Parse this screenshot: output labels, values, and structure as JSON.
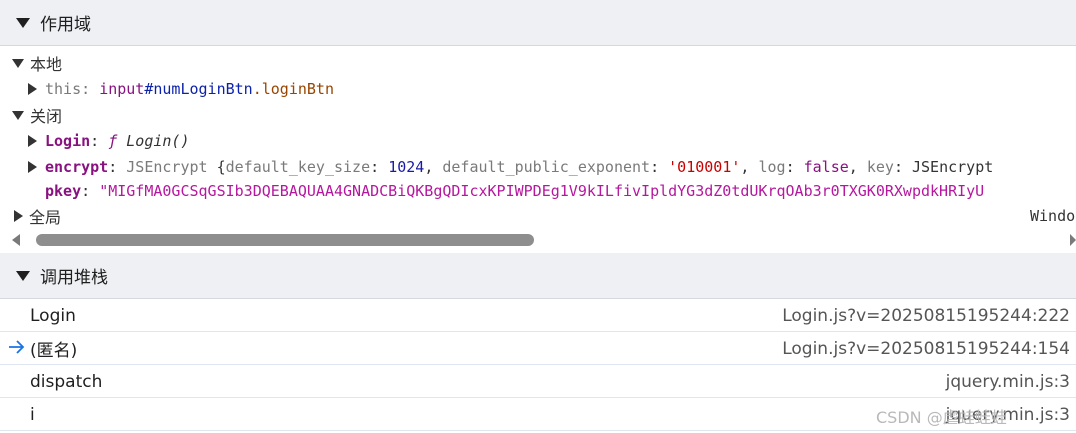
{
  "scope_section": {
    "title": "作用域"
  },
  "scope": {
    "local": {
      "label": "本地",
      "this_key": "this",
      "this_value_tag": "input",
      "this_value_id": "#numLoginBtn",
      "this_value_class": ".loginBtn"
    },
    "closure": {
      "label": "关闭",
      "login_key": "Login",
      "login_value_f": "ƒ",
      "login_value_name": "Login()",
      "encrypt_key": "encrypt",
      "encrypt_type": "JSEncrypt",
      "encrypt_brace": "{",
      "encrypt_p1_key": "default_key_size",
      "encrypt_p1_val": "1024",
      "encrypt_p2_key": "default_public_exponent",
      "encrypt_p2_val": "'010001'",
      "encrypt_p3_key": "log",
      "encrypt_p3_val": "false",
      "encrypt_p4_key": "key",
      "encrypt_p4_val": "JSEncrypt",
      "pkey_key": "pkey",
      "pkey_value": "\"MIGfMA0GCSqGSIb3DQEBAQUAA4GNADCBiQKBgQDIcxKPIWPDEg1V9kILfivIpldYG3dZ0tdUKrqOAb3r0TXGK0RXwpdkHRIyU"
    },
    "global": {
      "label": "全局",
      "value": "Windo"
    }
  },
  "callstack_section": {
    "title": "调用堆栈"
  },
  "callstack": [
    {
      "name": "Login",
      "location": "Login.js?v=20250815195244:222",
      "current": false
    },
    {
      "name": "(匿名)",
      "location": "Login.js?v=20250815195244:154",
      "current": true
    },
    {
      "name": "dispatch",
      "location": "jquery.min.js:3",
      "current": false
    },
    {
      "name": "i",
      "location": "jquery.min.js:3",
      "current": false
    }
  ],
  "icons": {
    "current_frame": "right-arrow-icon"
  },
  "watermark": "CSDN @虐蛙蛙蛙",
  "colors": {
    "header_bg": "#eef0f3",
    "keyword": "#881280",
    "string": "#c80000",
    "number": "#1a1aa6"
  }
}
